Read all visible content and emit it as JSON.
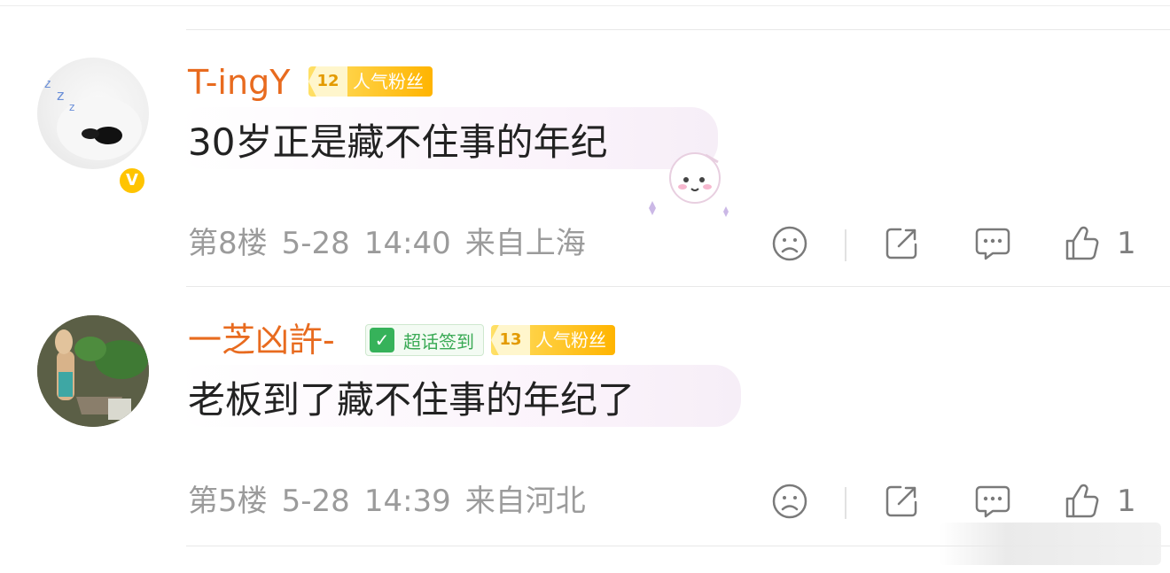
{
  "comments": [
    {
      "username": "T-ingY",
      "verified_badge": "V",
      "badges": {
        "fan_level": "12",
        "fan_label": "人气粉丝"
      },
      "content": "30岁正是藏不住事的年纪",
      "floor": "第8楼",
      "date": "5-28",
      "time": "14:40",
      "location": "来自上海",
      "like_count": "1"
    },
    {
      "username": "一芝凶許-",
      "badges": {
        "checkin_label": "超话签到",
        "fan_level": "13",
        "fan_label": "人气粉丝"
      },
      "content": "老板到了藏不住事的年纪了",
      "floor": "第5楼",
      "date": "5-28",
      "time": "14:39",
      "location": "来自河北",
      "like_count": "1"
    }
  ],
  "colors": {
    "username": "#e86b1f",
    "fan_badge": "#ffb400",
    "checkin_badge": "#36b25a",
    "meta_text": "#9b9b9b",
    "content_text": "#222222"
  },
  "icons": [
    "sad-face-icon",
    "share-icon",
    "comment-icon",
    "thumbs-up-icon",
    "check-icon",
    "sticker-icon"
  ]
}
